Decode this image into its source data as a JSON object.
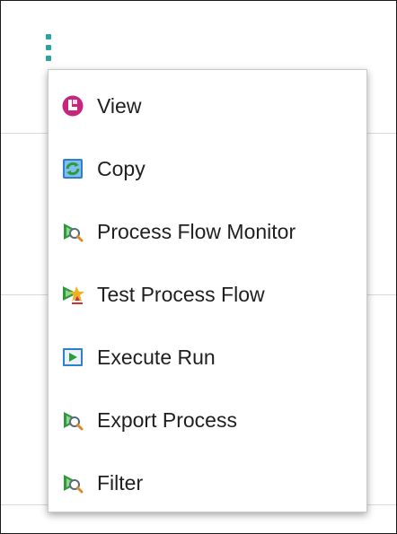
{
  "menu": {
    "items": [
      {
        "label": "View",
        "icon": "view-icon"
      },
      {
        "label": "Copy",
        "icon": "copy-icon"
      },
      {
        "label": "Process Flow Monitor",
        "icon": "process-monitor-icon"
      },
      {
        "label": "Test Process Flow",
        "icon": "test-process-icon"
      },
      {
        "label": "Execute Run",
        "icon": "execute-run-icon"
      },
      {
        "label": "Export Process",
        "icon": "export-process-icon"
      },
      {
        "label": "Filter",
        "icon": "filter-icon"
      }
    ]
  },
  "colors": {
    "kebab": "#2aa3a3",
    "view_icon": "#c8267e",
    "process_green": "#2e9a3a",
    "execute_blue": "#2f7fd0"
  }
}
